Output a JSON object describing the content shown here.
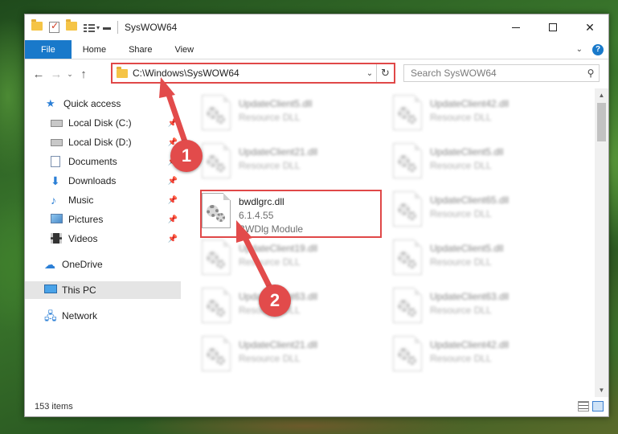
{
  "window": {
    "title": "SysWOW64"
  },
  "ribbon": {
    "tabs": [
      "File",
      "Home",
      "Share",
      "View"
    ]
  },
  "nav": {
    "address": "C:\\Windows\\SysWOW64",
    "search_placeholder": "Search SysWOW64"
  },
  "sidebar": {
    "items": [
      {
        "label": "Quick access",
        "icon": "star-icon"
      },
      {
        "label": "Local Disk (C:)",
        "icon": "drive-icon"
      },
      {
        "label": "Local Disk (D:)",
        "icon": "drive-icon"
      },
      {
        "label": "Documents",
        "icon": "documents-icon"
      },
      {
        "label": "Downloads",
        "icon": "download-icon"
      },
      {
        "label": "Music",
        "icon": "music-icon"
      },
      {
        "label": "Pictures",
        "icon": "pictures-icon"
      },
      {
        "label": "Videos",
        "icon": "videos-icon"
      },
      {
        "label": "OneDrive",
        "icon": "cloud-icon"
      },
      {
        "label": "This PC",
        "icon": "computer-icon"
      },
      {
        "label": "Network",
        "icon": "network-icon"
      }
    ]
  },
  "files": {
    "highlighted": {
      "name": "bwdlgrc.dll",
      "version": "6.1.4.55",
      "description": "BWDlg Module"
    },
    "blurred": [
      {
        "name": "UpdateClient5.dll",
        "type": "Resource DLL"
      },
      {
        "name": "UpdateClient42.dll",
        "type": "Resource DLL"
      },
      {
        "name": "UpdateClient21.dll",
        "type": "Resource DLL"
      },
      {
        "name": "UpdateClient5.dll",
        "type": "Resource DLL"
      },
      {
        "name": "UpdateClient65.dll",
        "type": "Resource DLL"
      },
      {
        "name": "UpdateClient19.dll",
        "type": "Resource DLL"
      },
      {
        "name": "UpdateClient5.dll",
        "type": "Resource DLL"
      },
      {
        "name": "UpdateClient63.dll",
        "type": "Resource DLL"
      },
      {
        "name": "UpdateClient63.dll",
        "type": "Resource DLL"
      },
      {
        "name": "UpdateClient21.dll",
        "type": "Resource DLL"
      },
      {
        "name": "UpdateClient42.dll",
        "type": "Resource DLL"
      }
    ]
  },
  "status": {
    "items_count": "153 items"
  },
  "annotations": {
    "step1": "1",
    "step2": "2",
    "accent": "#e24b4b"
  }
}
